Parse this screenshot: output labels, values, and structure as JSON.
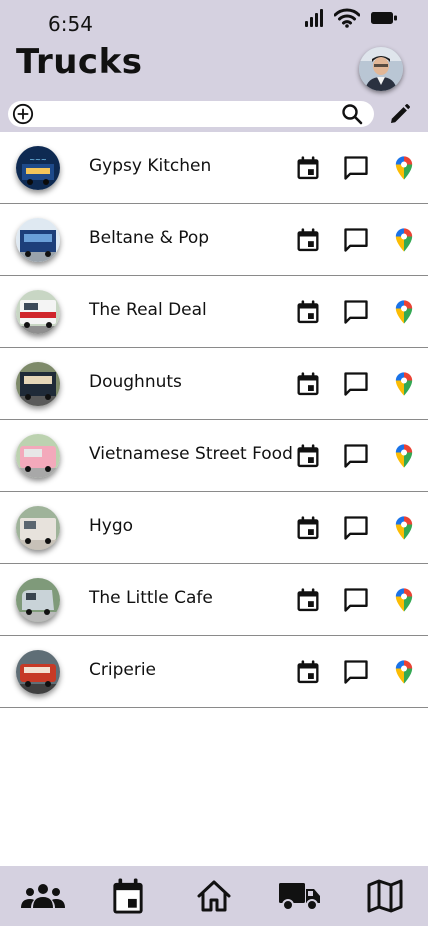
{
  "status_bar": {
    "time": "6:54"
  },
  "header": {
    "title": "Trucks"
  },
  "search": {
    "placeholder": "",
    "value": ""
  },
  "trucks": [
    {
      "name": "Gypsy Kitchen"
    },
    {
      "name": "Beltane & Pop"
    },
    {
      "name": "The Real Deal"
    },
    {
      "name": "Doughnuts"
    },
    {
      "name": "Vietnamese Street Food"
    },
    {
      "name": "Hygo"
    },
    {
      "name": "The Little Cafe"
    },
    {
      "name": "Criperie"
    }
  ],
  "icons": {
    "add": "add-circle-icon",
    "search": "search-icon",
    "edit": "pencil-icon",
    "row_calendar": "calendar-icon",
    "row_chat": "chat-icon",
    "row_map": "map-pin-icon",
    "nav": [
      "people-icon",
      "calendar-icon",
      "home-icon",
      "truck-icon",
      "map-icon"
    ]
  },
  "colors": {
    "header_bg": "#d5d1e0",
    "nav_bg": "#d5d1e0",
    "divider": "#8a8a8a"
  }
}
